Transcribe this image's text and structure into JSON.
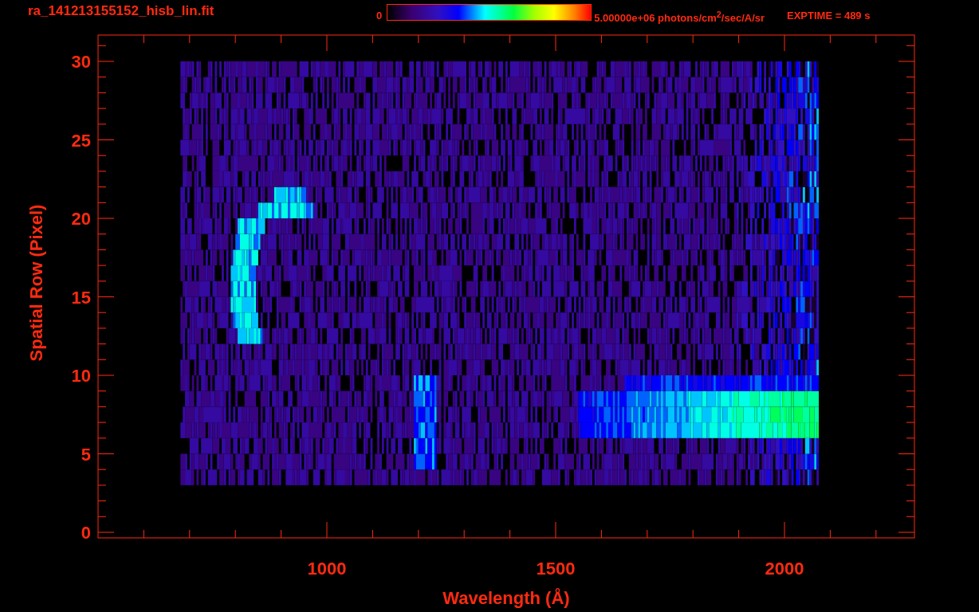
{
  "title": "ra_141213155152_hisb_lin.fit",
  "colorbar": {
    "min_label": "0",
    "max_label": "5.00000e+06 photons/cm$^{2}$/sec/A/sr"
  },
  "exposure": "EXPTIME = 489 s",
  "x_axis": {
    "title": "Wavelength (Å)",
    "ticks": [
      "1000",
      "1500",
      "2000"
    ]
  },
  "y_axis": {
    "title": "Spatial Row (Pixel)",
    "ticks": [
      "30",
      "25",
      "20",
      "15",
      "10",
      "5",
      "0"
    ]
  }
}
